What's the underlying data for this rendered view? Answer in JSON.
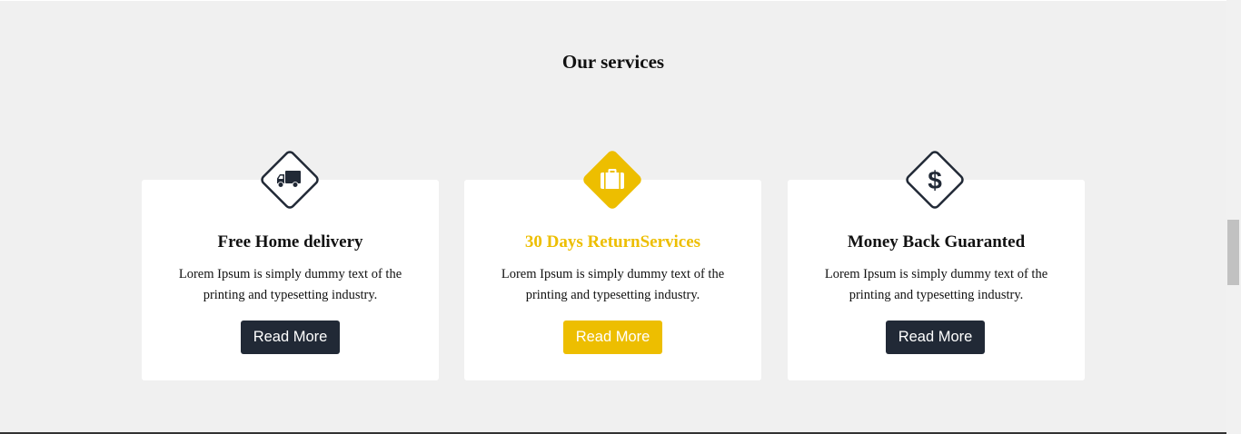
{
  "section": {
    "title": "Our services"
  },
  "colors": {
    "accent": "#edbe00",
    "dark": "#212936",
    "background": "#f0f0f0",
    "card": "#ffffff"
  },
  "services": [
    {
      "icon": "truck-icon",
      "title": "Free Home delivery",
      "text": "Lorem Ipsum is simply dummy text of the printing and typesetting industry.",
      "button": "Read More"
    },
    {
      "icon": "briefcase-icon",
      "title": "30 Days ReturnServices",
      "text": "Lorem Ipsum is simply dummy text of the printing and typesetting industry.",
      "button": "Read More"
    },
    {
      "icon": "dollar-icon",
      "title": "Money Back Guaranted",
      "text": "Lorem Ipsum is simply dummy text of the printing and typesetting industry.",
      "button": "Read More"
    }
  ]
}
